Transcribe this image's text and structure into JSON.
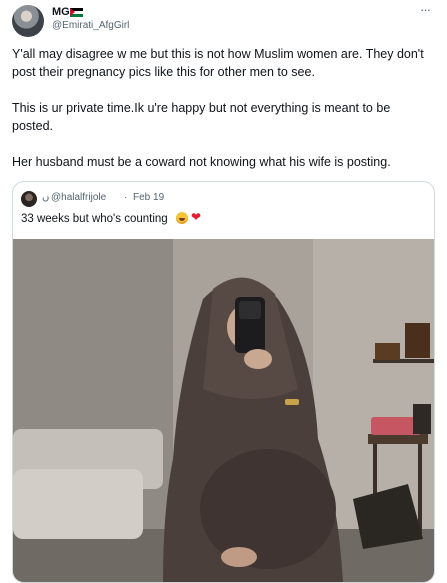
{
  "tweet": {
    "author_name": "MG",
    "author_handle": "@Emirati_AfgGirl",
    "more_icon": "more-horizontal-icon",
    "paragraphs": [
      "Y'all may disagree w me but this is not how Muslim women are. They don't post their pregnancy pics like this for other men to see.",
      "This is ur private time.Ik u're happy but not everything is meant to be posted.",
      "Her husband must be a coward not knowing what his wife is posting."
    ]
  },
  "quote": {
    "name_glyph": "ں",
    "handle": "@halalfrijole",
    "separator": "·",
    "date": "Feb 19",
    "text": "33 weeks but who's counting",
    "emojis": [
      "laughing-face-emoji",
      "red-heart-emoji"
    ]
  },
  "colors": {
    "text_primary": "#0f1419",
    "text_secondary": "#536471",
    "card_border": "#cfd9de",
    "flag_red": "#c8102e",
    "flag_black": "#000000",
    "flag_white": "#ffffff",
    "flag_green": "#007a3d"
  }
}
